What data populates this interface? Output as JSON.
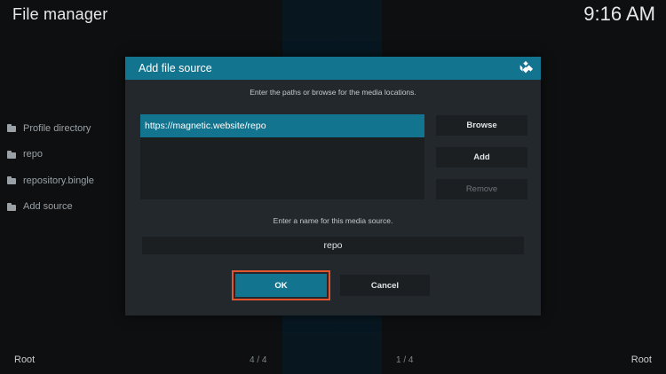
{
  "app": {
    "title": "File manager",
    "clock": "9:16 AM"
  },
  "sidebar": {
    "items": [
      {
        "label": "Profile directory"
      },
      {
        "label": "repo"
      },
      {
        "label": "repository.bingle"
      },
      {
        "label": "Add source"
      }
    ]
  },
  "footer": {
    "left": "Root",
    "right": "Root",
    "left_count": "4 / 4",
    "right_count": "1 / 4"
  },
  "dialog": {
    "title": "Add file source",
    "instructions": "Enter the paths or browse for the media locations.",
    "paths": [
      "https://magnetic.website/repo"
    ],
    "buttons": {
      "browse": "Browse",
      "add": "Add",
      "remove": "Remove",
      "ok": "OK",
      "cancel": "Cancel"
    },
    "name_label": "Enter a name for this media source.",
    "name_value": "repo"
  },
  "colors": {
    "accent": "#13748f",
    "highlight": "#e2552e",
    "dialog_bg": "#23282c"
  }
}
